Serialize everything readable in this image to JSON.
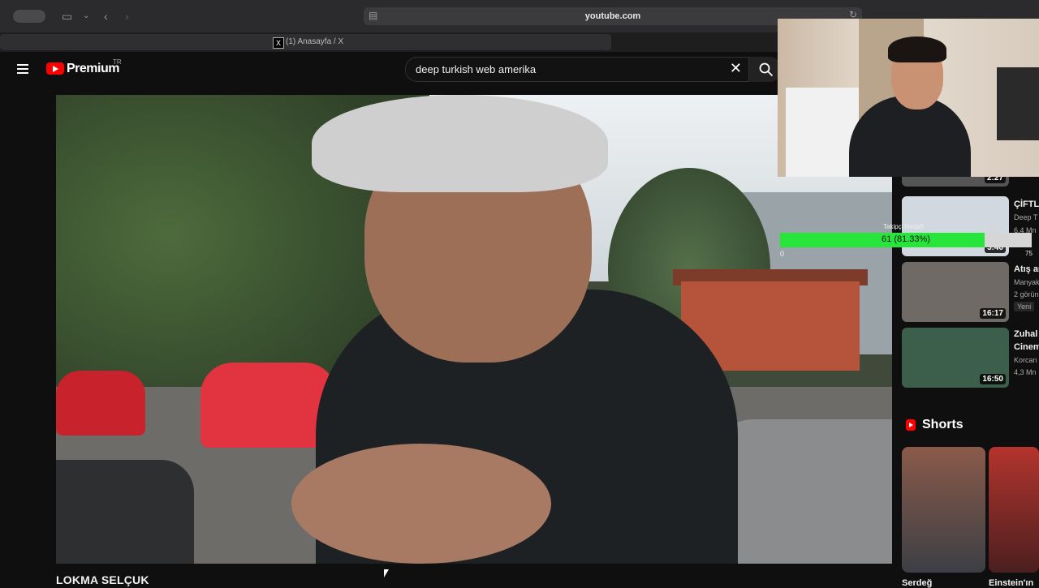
{
  "browser": {
    "url": "youtube.com",
    "tab_title": "(1) Anasayfa / X"
  },
  "header": {
    "brand": "Premium",
    "region": "TR",
    "search_value": "deep turkish web amerika"
  },
  "video": {
    "title": "LOKMA SELÇUK"
  },
  "related": [
    {
      "duration": "2:27",
      "title": "",
      "channel": "",
      "meta": ""
    },
    {
      "duration": "5:40",
      "title": "ÇİFTL",
      "channel": "Deep T",
      "meta": "6,4 Mn"
    },
    {
      "duration": "16:17",
      "title": "Atış ar",
      "channel": "Manyak",
      "meta": "2 görün",
      "badge": "Yeni"
    },
    {
      "duration": "16:50",
      "title": "Zuhal",
      "channel": "Cinem",
      "meta": "Korcan",
      "meta2": "4,3 Mn"
    }
  ],
  "shorts": {
    "label": "Shorts",
    "items": [
      {
        "title": "Serdeğ"
      },
      {
        "title": "Einstein'ın"
      }
    ]
  },
  "overlay": {
    "goal_label": "Takipçi Hedefi",
    "goal_text": "61 (81.33%)",
    "goal_fraction": 0.8133,
    "goal_min": "0",
    "goal_max": "75"
  },
  "colors": {
    "yt_red": "#ff0000",
    "goal_green": "#27e53a"
  }
}
